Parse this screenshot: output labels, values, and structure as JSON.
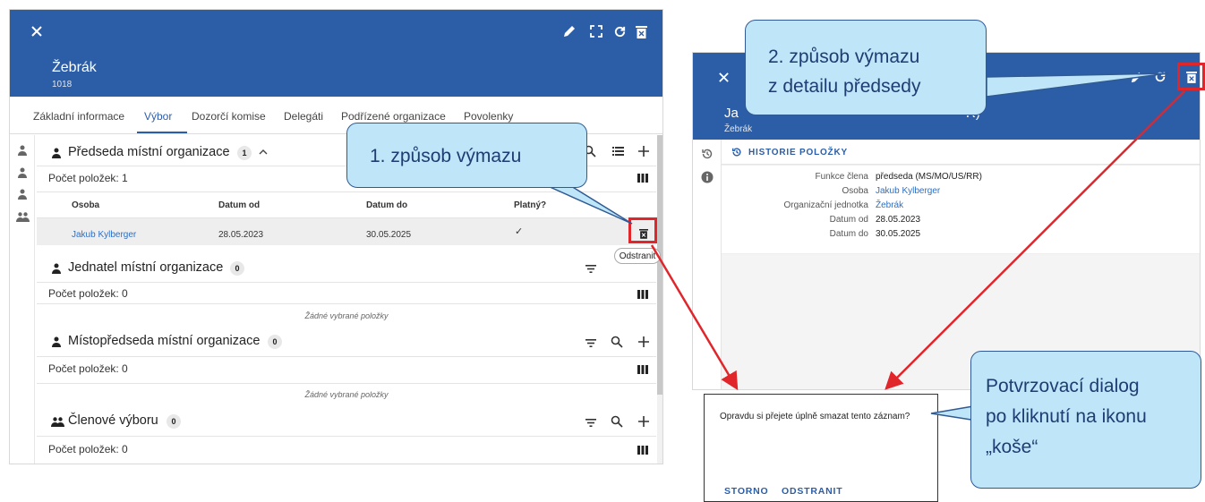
{
  "left_panel": {
    "title": "Žebrák",
    "subtitle": "1018",
    "tabs": [
      "Základní informace",
      "Výbor",
      "Dozorčí komise",
      "Delegáti",
      "Podřízené organizace",
      "Povolenky"
    ],
    "active_tab": "Výbor",
    "sections": [
      {
        "title": "Předseda místní organizace",
        "badge": "1",
        "count_text": "Počet položek: 1",
        "columns": [
          "Osoba",
          "Datum od",
          "Datum do",
          "Platný?"
        ],
        "row": {
          "person": "Jakub Kylberger",
          "date_from": "28.05.2023",
          "date_to": "30.05.2025",
          "valid": "✓"
        }
      },
      {
        "title": "Jednatel místní organizace",
        "badge": "0",
        "count_text": "Počet položek: 0",
        "empty_text": "Žádné vybrané položky"
      },
      {
        "title": "Místopředseda místní organizace",
        "badge": "0",
        "count_text": "Počet položek: 0",
        "empty_text": "Žádné vybrané položky"
      },
      {
        "title": "Členové výboru",
        "badge": "0",
        "count_text": "Počet položek: 0"
      }
    ],
    "tooltip": "Odstranit"
  },
  "right_panel": {
    "title_left": "Ja",
    "title_right": "R)",
    "subtitle": "Žebrák",
    "history_label": "HISTORIE POLOŽKY",
    "details": [
      {
        "label": "Funkce člena",
        "value": "předseda (MS/MO/US/RR)",
        "link": false
      },
      {
        "label": "Osoba",
        "value": "Jakub Kylberger",
        "link": true
      },
      {
        "label": "Organizační jednotka",
        "value": "Žebrák",
        "link": true
      },
      {
        "label": "Datum od",
        "value": "28.05.2023",
        "link": false
      },
      {
        "label": "Datum do",
        "value": "30.05.2025",
        "link": false
      }
    ]
  },
  "dialog": {
    "question": "Opravdu si přejete úplně smazat tento záznam?",
    "cancel_label": "STORNO",
    "confirm_label": "ODSTRANIT"
  },
  "callouts": {
    "first": "1. způsob výmazu",
    "second_line1": "2. způsob výmazu",
    "second_line2": "z detailu předsedy",
    "dialog_line1": "Potvrzovací dialog",
    "dialog_line2": "po kliknutí na ikonu",
    "dialog_line3": "„koše“"
  },
  "colors": {
    "header_blue": "#2c5ea8",
    "link_blue": "#2c6fc4",
    "callout_fill": "#bfe6f8",
    "callout_border": "#2f5a93",
    "highlight_red": "#e0262b"
  },
  "icons": [
    "close-icon",
    "edit-icon",
    "fullscreen-icon",
    "refresh-icon",
    "delete-icon",
    "person-icon",
    "group-icon",
    "chevron-up-icon",
    "search-icon",
    "list-icon",
    "add-icon",
    "filter-icon",
    "columns-icon",
    "check-icon",
    "history-icon",
    "info-icon"
  ]
}
